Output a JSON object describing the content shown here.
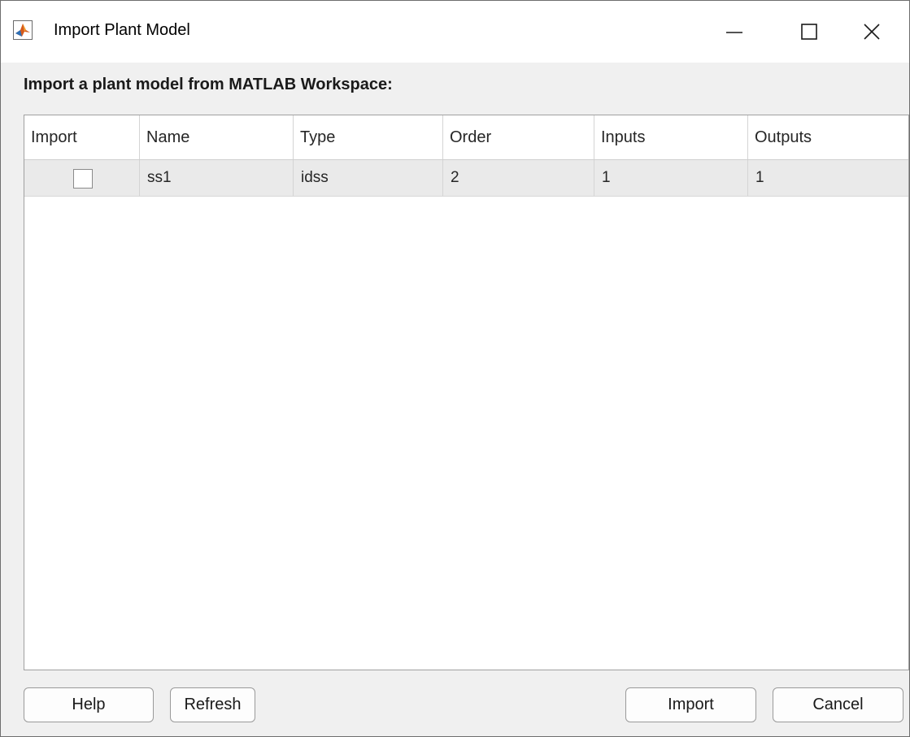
{
  "window": {
    "title": "Import Plant Model",
    "icon": "matlab-icon"
  },
  "controls": {
    "minimize": "minimize-icon",
    "maximize": "maximize-icon",
    "close": "close-icon"
  },
  "prompt": "Import a plant model from MATLAB Workspace:",
  "table": {
    "columns": [
      "Import",
      "Name",
      "Type",
      "Order",
      "Inputs",
      "Outputs"
    ],
    "rows": [
      {
        "import": false,
        "name": "ss1",
        "type": "idss",
        "order": "2",
        "inputs": "1",
        "outputs": "1"
      }
    ]
  },
  "buttons": {
    "help": "Help",
    "refresh": "Refresh",
    "import": "Import",
    "cancel": "Cancel"
  }
}
